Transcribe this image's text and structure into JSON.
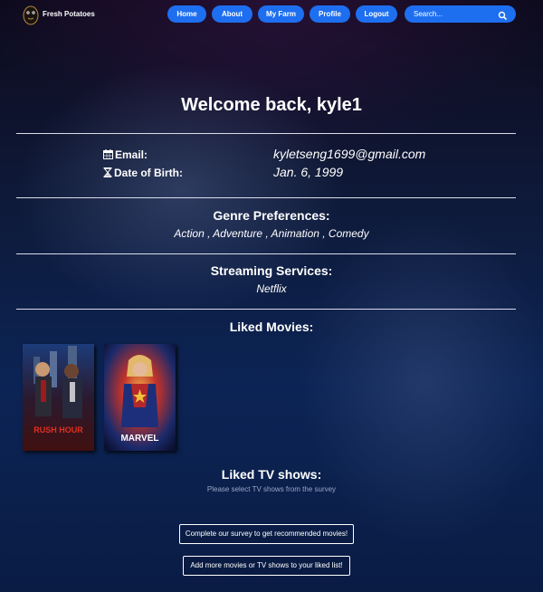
{
  "nav": {
    "brand": "Fresh Potatoes",
    "links": [
      "Home",
      "About",
      "My Farm",
      "Profile",
      "Logout"
    ],
    "search_placeholder": "Search...",
    "search_icon": "magnifier-icon",
    "accent_color": "#1e6ff0"
  },
  "profile": {
    "welcome": "Welcome back, kyle1",
    "email_label": "Email:",
    "email_value": "kyletseng1699@gmail.com",
    "email_icon": "calendar-icon",
    "dob_label": "Date of Birth:",
    "dob_value": "Jan. 6, 1999",
    "dob_icon": "hourglass-icon"
  },
  "genres": {
    "title": "Genre Preferences:",
    "list": "Action , Adventure , Animation , Comedy"
  },
  "streaming": {
    "title": "Streaming Services:",
    "list": "Netflix"
  },
  "liked_movies": {
    "title": "Liked Movies:",
    "posters": [
      {
        "title": "RUSH HOUR"
      },
      {
        "title": "MARVEL"
      }
    ]
  },
  "liked_tv": {
    "title": "Liked TV shows:",
    "hint": "Please select TV shows from the survey"
  },
  "actions": {
    "survey": "Complete our survey to get recommended movies!",
    "add_more": "Add more movies or TV shows to your liked list!"
  }
}
